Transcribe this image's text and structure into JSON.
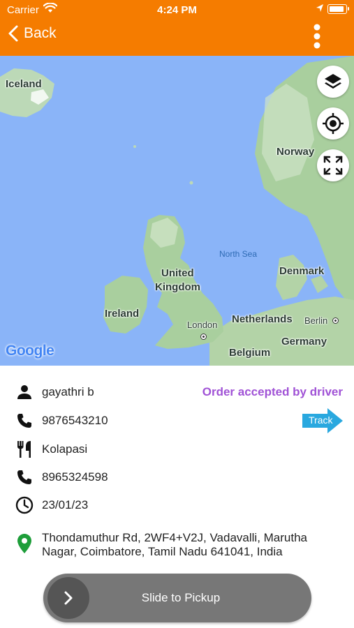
{
  "status_bar": {
    "carrier": "Carrier",
    "time": "4:24 PM"
  },
  "nav": {
    "back_label": "Back",
    "accent_color": "#f57c00"
  },
  "map": {
    "labels": {
      "iceland": "Iceland",
      "norway": "Norway",
      "north_sea": "North Sea",
      "united_kingdom_1": "United",
      "united_kingdom_2": "Kingdom",
      "denmark": "Denmark",
      "ireland": "Ireland",
      "london": "London",
      "netherlands": "Netherlands",
      "berlin": "Berlin",
      "germany": "Germany",
      "belgium": "Belgium"
    },
    "attribution": "Google",
    "buttons": [
      "layers-icon",
      "my-location-icon",
      "fullscreen-icon"
    ]
  },
  "order": {
    "customer_name": "gayathri b",
    "status": "Order accepted by driver",
    "status_color": "#a052d6",
    "customer_phone": "9876543210",
    "track_label": "Track",
    "restaurant": "Kolapasi",
    "restaurant_phone": "8965324598",
    "date": "23/01/23",
    "address": "Thondamuthur Rd, 2WF4+V2J, Vadavalli, Marutha Nagar, Coimbatore, Tamil Nadu 641041, India"
  },
  "slider": {
    "label": "Slide to Pickup"
  }
}
